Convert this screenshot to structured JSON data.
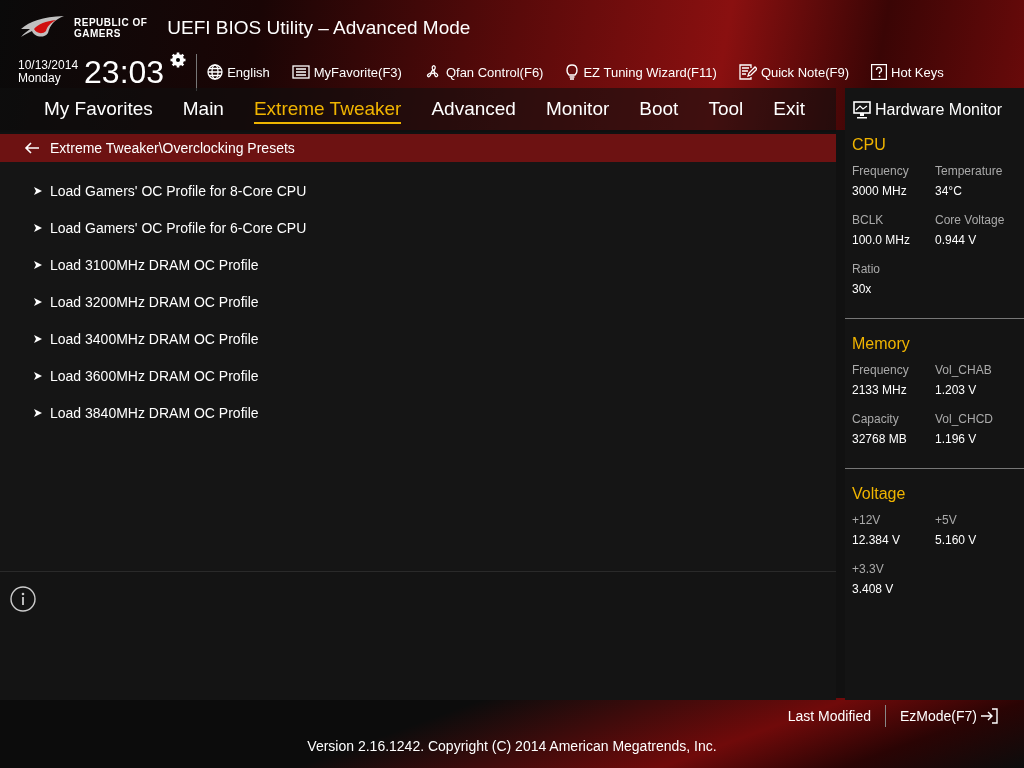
{
  "logo": {
    "lines": [
      "REPUBLIC OF",
      "GAMERS"
    ]
  },
  "window": {
    "title": "UEFI BIOS Utility – Advanced Mode"
  },
  "clock": {
    "date": "10/13/2014",
    "day": "Monday",
    "time": "23:03"
  },
  "toolbar": [
    {
      "kind": "language",
      "label": "English"
    },
    {
      "kind": "favorite",
      "label": "MyFavorite(F3)"
    },
    {
      "kind": "fan",
      "label": "Qfan Control(F6)"
    },
    {
      "kind": "wizard",
      "label": "EZ Tuning Wizard(F11)"
    },
    {
      "kind": "note",
      "label": "Quick Note(F9)"
    },
    {
      "kind": "hotkeys",
      "label": "Hot Keys"
    }
  ],
  "tabs": [
    {
      "label": "My Favorites",
      "selected": false
    },
    {
      "label": "Main",
      "selected": false
    },
    {
      "label": "Extreme Tweaker",
      "selected": true
    },
    {
      "label": "Advanced",
      "selected": false
    },
    {
      "label": "Monitor",
      "selected": false
    },
    {
      "label": "Boot",
      "selected": false
    },
    {
      "label": "Tool",
      "selected": false
    },
    {
      "label": "Exit",
      "selected": false
    }
  ],
  "breadcrumb": "Extreme Tweaker\\Overclocking Presets",
  "items": [
    "Load Gamers' OC Profile for 8-Core CPU",
    "Load Gamers' OC Profile for 6-Core CPU",
    "Load 3100MHz DRAM OC Profile",
    "Load 3200MHz DRAM OC Profile",
    "Load 3400MHz DRAM OC Profile",
    "Load 3600MHz DRAM OC Profile",
    "Load 3840MHz DRAM OC Profile"
  ],
  "hardware_monitor": {
    "title": "Hardware Monitor",
    "sections": [
      {
        "title": "CPU",
        "readings": [
          {
            "label": "Frequency",
            "value": "3000 MHz"
          },
          {
            "label": "Temperature",
            "value": "34°C"
          },
          {
            "label": "BCLK",
            "value": "100.0 MHz"
          },
          {
            "label": "Core Voltage",
            "value": "0.944 V"
          },
          {
            "label": "Ratio",
            "value": "30x"
          }
        ]
      },
      {
        "title": "Memory",
        "readings": [
          {
            "label": "Frequency",
            "value": "2133 MHz"
          },
          {
            "label": "Vol_CHAB",
            "value": "1.203 V"
          },
          {
            "label": "Capacity",
            "value": "32768 MB"
          },
          {
            "label": "Vol_CHCD",
            "value": "1.196 V"
          }
        ]
      },
      {
        "title": "Voltage",
        "readings": [
          {
            "label": "+12V",
            "value": "12.384 V"
          },
          {
            "label": "+5V",
            "value": "5.160 V"
          },
          {
            "label": "+3.3V",
            "value": "3.408 V"
          }
        ]
      }
    ]
  },
  "footer": {
    "last_modified": "Last Modified",
    "ez_mode": "EzMode(F7)",
    "version": "Version 2.16.1242. Copyright (C) 2014 American Megatrends, Inc."
  }
}
